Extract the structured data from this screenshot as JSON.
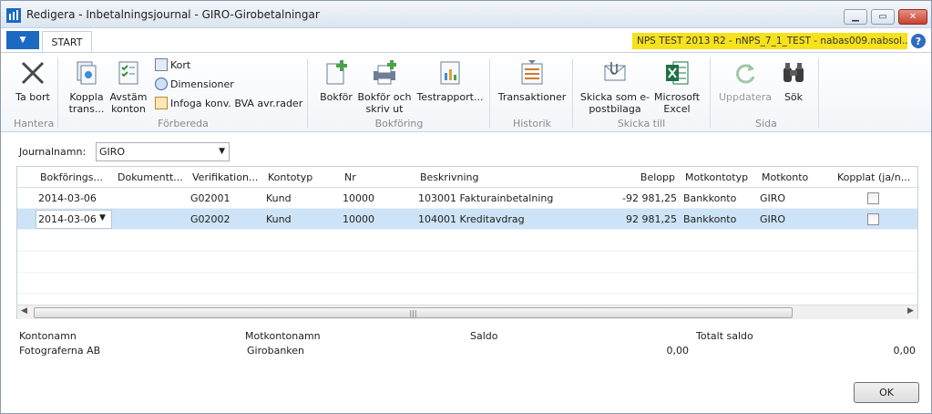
{
  "window": {
    "title": "Redigera - Inbetalningsjournal - GIRO-Girobetalningar",
    "min": "▁",
    "max": "▭",
    "close": "✕"
  },
  "ribbon_tabs": {
    "app_menu": "▼",
    "start": "START",
    "env": "NPS TEST 2013 R2 - nNPS_7_1_TEST - nabas009.nabsol...",
    "help": "?"
  },
  "ribbon": {
    "ta_bort": "Ta bort",
    "hantera": "Hantera",
    "koppla": "Koppla trans...",
    "avstam": "Avstäm konton",
    "kort": "Kort",
    "dimensioner": "Dimensioner",
    "infoga": "Infoga konv. BVA avr.rader",
    "forbereda": "Förbereda",
    "bokfor": "Bokför",
    "bokfor_skriv": "Bokför och skriv ut",
    "testrapport": "Testrapport...",
    "bokforing": "Bokföring",
    "transaktioner": "Transaktioner",
    "historik": "Historik",
    "skicka_epost": "Skicka som e-postbilaga",
    "excel": "Microsoft Excel",
    "skicka_till": "Skicka till",
    "uppdatera": "Uppdatera",
    "sok": "Sök",
    "sida": "Sida"
  },
  "journal": {
    "label": "Journalnamn:",
    "value": "GIRO"
  },
  "grid": {
    "headers": {
      "bokforingsdatum": "Bokförings...",
      "dokumenttyp": "Dokumentt...",
      "verifikation": "Verifikation...",
      "kontotyp": "Kontotyp",
      "nr": "Nr",
      "beskrivning": "Beskrivning",
      "belopp": "Belopp",
      "motkontotyp": "Motkontotyp",
      "motkonto": "Motkonto",
      "kopplat": "Kopplat (ja/n..."
    },
    "rows": [
      {
        "date": "2014-03-06",
        "doc": "",
        "ver": "G02001",
        "kontotyp": "Kund",
        "nr": "10000",
        "beskrivning": "103001 Fakturainbetalning",
        "belopp": "-92 981,25",
        "motkontotyp": "Bankkonto",
        "motkonto": "GIRO",
        "kopplat": false
      },
      {
        "date": "2014-03-06",
        "doc": "",
        "ver": "G02002",
        "kontotyp": "Kund",
        "nr": "10000",
        "beskrivning": "104001 Kreditavdrag",
        "belopp": "92 981,25",
        "motkontotyp": "Bankkonto",
        "motkonto": "GIRO",
        "kopplat": false
      }
    ],
    "scroll_grip": "|||"
  },
  "footer": {
    "kontonamn_label": "Kontonamn",
    "kontonamn_value": "Fotograferna AB",
    "motkontonamn_label": "Motkontonamn",
    "motkontonamn_value": "Girobanken",
    "saldo_label": "Saldo",
    "saldo_value": "0,00",
    "totalt_saldo_label": "Totalt saldo",
    "totalt_saldo_value": "0,00"
  },
  "ok_button": "OK",
  "colors": {
    "accent": "#1c69c3",
    "env_bg": "#f5e11c",
    "selected_row": "#cde3f7",
    "excel_green": "#1e7145"
  }
}
